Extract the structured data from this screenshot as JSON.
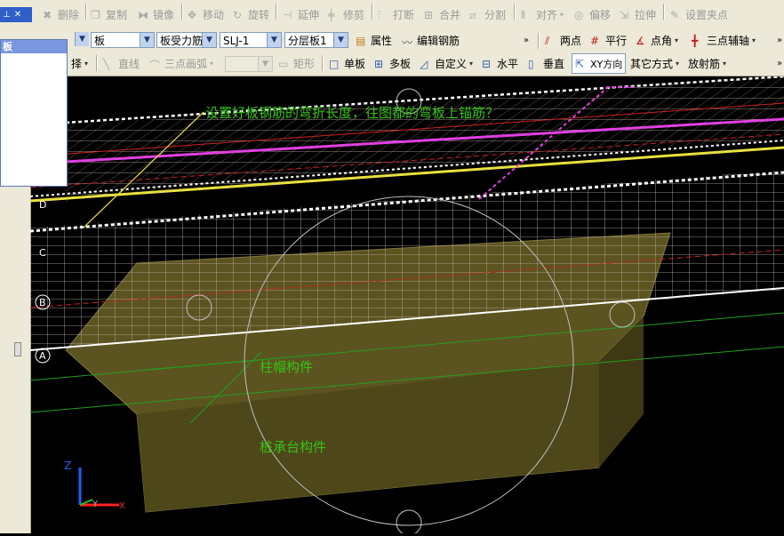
{
  "toolbar_row1": {
    "delete": "删除",
    "copy": "复制",
    "mirror": "镜像",
    "move": "移动",
    "rotate": "旋转",
    "extend": "延伸",
    "trim": "修剪",
    "break": "打断",
    "merge": "合并",
    "split": "分割",
    "align": "对齐",
    "offset": "偏移",
    "stretch": "拉伸",
    "grip": "设置夹点"
  },
  "toolbar_row2": {
    "category_value": "板",
    "rebar_type_value": "板受力筋",
    "rebar_name_value": "SLJ-1",
    "layer_value": "分层板1",
    "properties": "属性",
    "edit_rebar": "编辑钢筋",
    "two_points": "两点",
    "parallel": "平行",
    "point_angle": "点角",
    "three_point_aux": "三点辅轴"
  },
  "toolbar_row3": {
    "select": "择",
    "line": "直线",
    "arc": "三点画弧",
    "rect": "矩形",
    "single_slab": "单板",
    "multi_slab": "多板",
    "custom": "自定义",
    "horizontal": "水平",
    "vertical": "垂直",
    "xy_dir": "XY方向",
    "other": "其它方式",
    "radial": "放射筋"
  },
  "left_panel": {
    "title": "板"
  },
  "canvas": {
    "annotation": "设置好板钢筋的弯折长度，往图都的弯板上锚筋？",
    "pile_cap_label": "柱帽构件",
    "pile_foundation_label": "桩承台构件",
    "axis_a": "A",
    "axis_b": "B",
    "axis_c": "C",
    "axis_d": "D",
    "z_axis": "Z",
    "y_axis": "Y",
    "x_axis": "X"
  },
  "colors": {
    "toolbar_bg": "#ece9d8",
    "canvas_bg": "#000000",
    "annotation_text": "#34c414",
    "magenta_rebar": "#e040e0",
    "yellow_rebar": "#e8e040",
    "cap_fill": "#5a5420"
  }
}
